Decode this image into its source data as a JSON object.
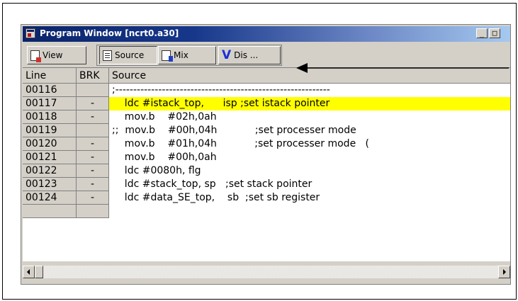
{
  "window": {
    "title": "Program Window [ncrt0.a30]",
    "minimize_label": "_",
    "restore_label": "□"
  },
  "toolbar": {
    "view_label": "View",
    "source_label": "Source",
    "mix_label": "Mix",
    "dis_label": "Dis ...",
    "dis_glyph": "V"
  },
  "grid": {
    "headers": {
      "line": "Line",
      "brk": "BRK",
      "source": "Source"
    },
    "rows": [
      {
        "line": "00116",
        "brk": "",
        "source": ";------------------------------------------------------------"
      },
      {
        "line": "00117",
        "brk": "-",
        "source": "    ldc #istack_top,      isp ;set istack pointer"
      },
      {
        "line": "00118",
        "brk": "-",
        "source": "    mov.b    #02h,0ah"
      },
      {
        "line": "00119",
        "brk": "",
        "source": ";;  mov.b    #00h,04h            ;set processer mode"
      },
      {
        "line": "00120",
        "brk": "-",
        "source": "    mov.b    #01h,04h            ;set processer mode   ("
      },
      {
        "line": "00121",
        "brk": "-",
        "source": "    mov.b    #00h,0ah"
      },
      {
        "line": "00122",
        "brk": "-",
        "source": "    ldc #0080h, flg"
      },
      {
        "line": "00123",
        "brk": "-",
        "source": "    ldc #stack_top, sp   ;set stack pointer"
      },
      {
        "line": "00124",
        "brk": "-",
        "source": "    ldc #data_SE_top,    sb  ;set sb register"
      },
      {
        "line": "",
        "brk": "",
        "source": ""
      }
    ],
    "highlight_row_index": 1,
    "highlight_color": "#ffff00"
  },
  "colors": {
    "titlebar_start": "#0a246a",
    "titlebar_end": "#a6caf0",
    "face": "#d4d0c8",
    "dis_icon": "#1a2ed8"
  }
}
